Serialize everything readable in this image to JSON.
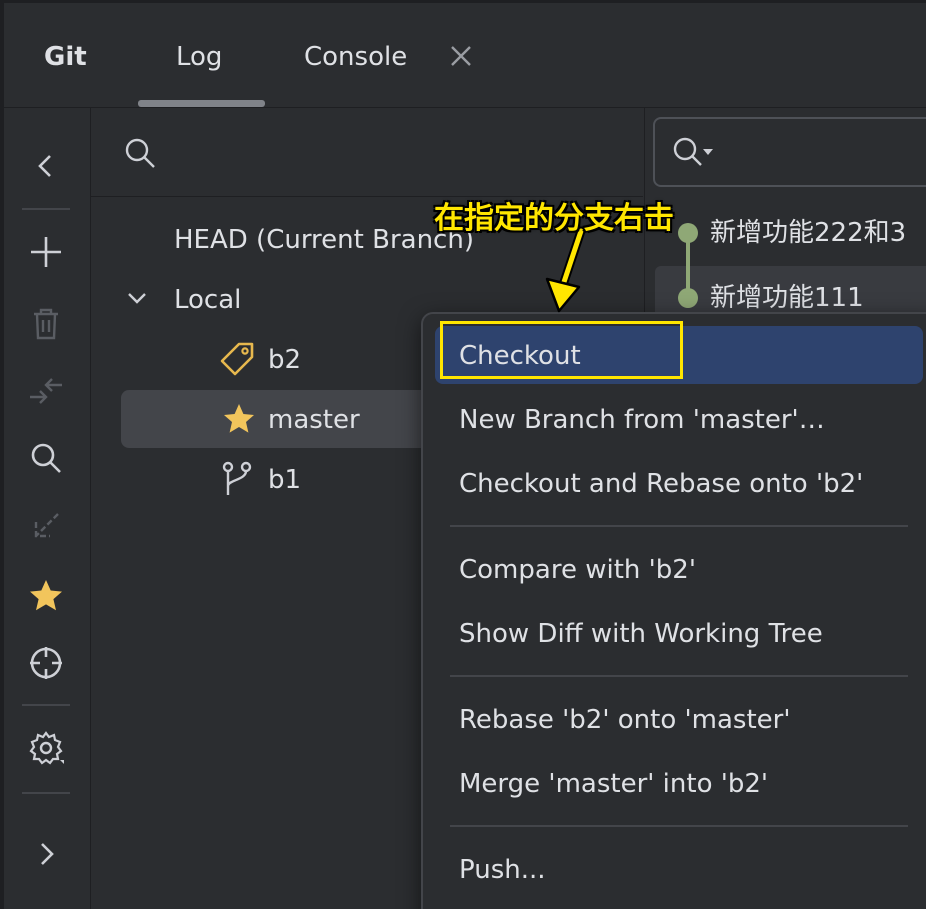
{
  "tabs": {
    "git": "Git",
    "log": "Log",
    "console": "Console"
  },
  "branch_tree": {
    "head": "HEAD (Current Branch)",
    "local_label": "Local",
    "branches": [
      {
        "name": "b2",
        "icon": "tag-icon"
      },
      {
        "name": "master",
        "icon": "star-icon"
      },
      {
        "name": "b1",
        "icon": "branch-icon"
      }
    ]
  },
  "commits": [
    "新增功能222和3",
    "新增功能111"
  ],
  "context_menu": {
    "items": [
      "Checkout",
      "New Branch from 'master'…",
      "Checkout and Rebase onto 'b2'",
      "Compare with 'b2'",
      "Show Diff with Working Tree",
      "Rebase 'b2' onto 'master'",
      "Merge 'master' into 'b2'",
      "Push..."
    ]
  },
  "annotation": {
    "text": "在指定的分支右击"
  },
  "colors": {
    "background": "#2b2d30",
    "selection": "#43454a",
    "menu_highlight": "#2e436e",
    "annotation": "#ffe600",
    "star": "#f2c55c",
    "graph": "#8fa876"
  }
}
